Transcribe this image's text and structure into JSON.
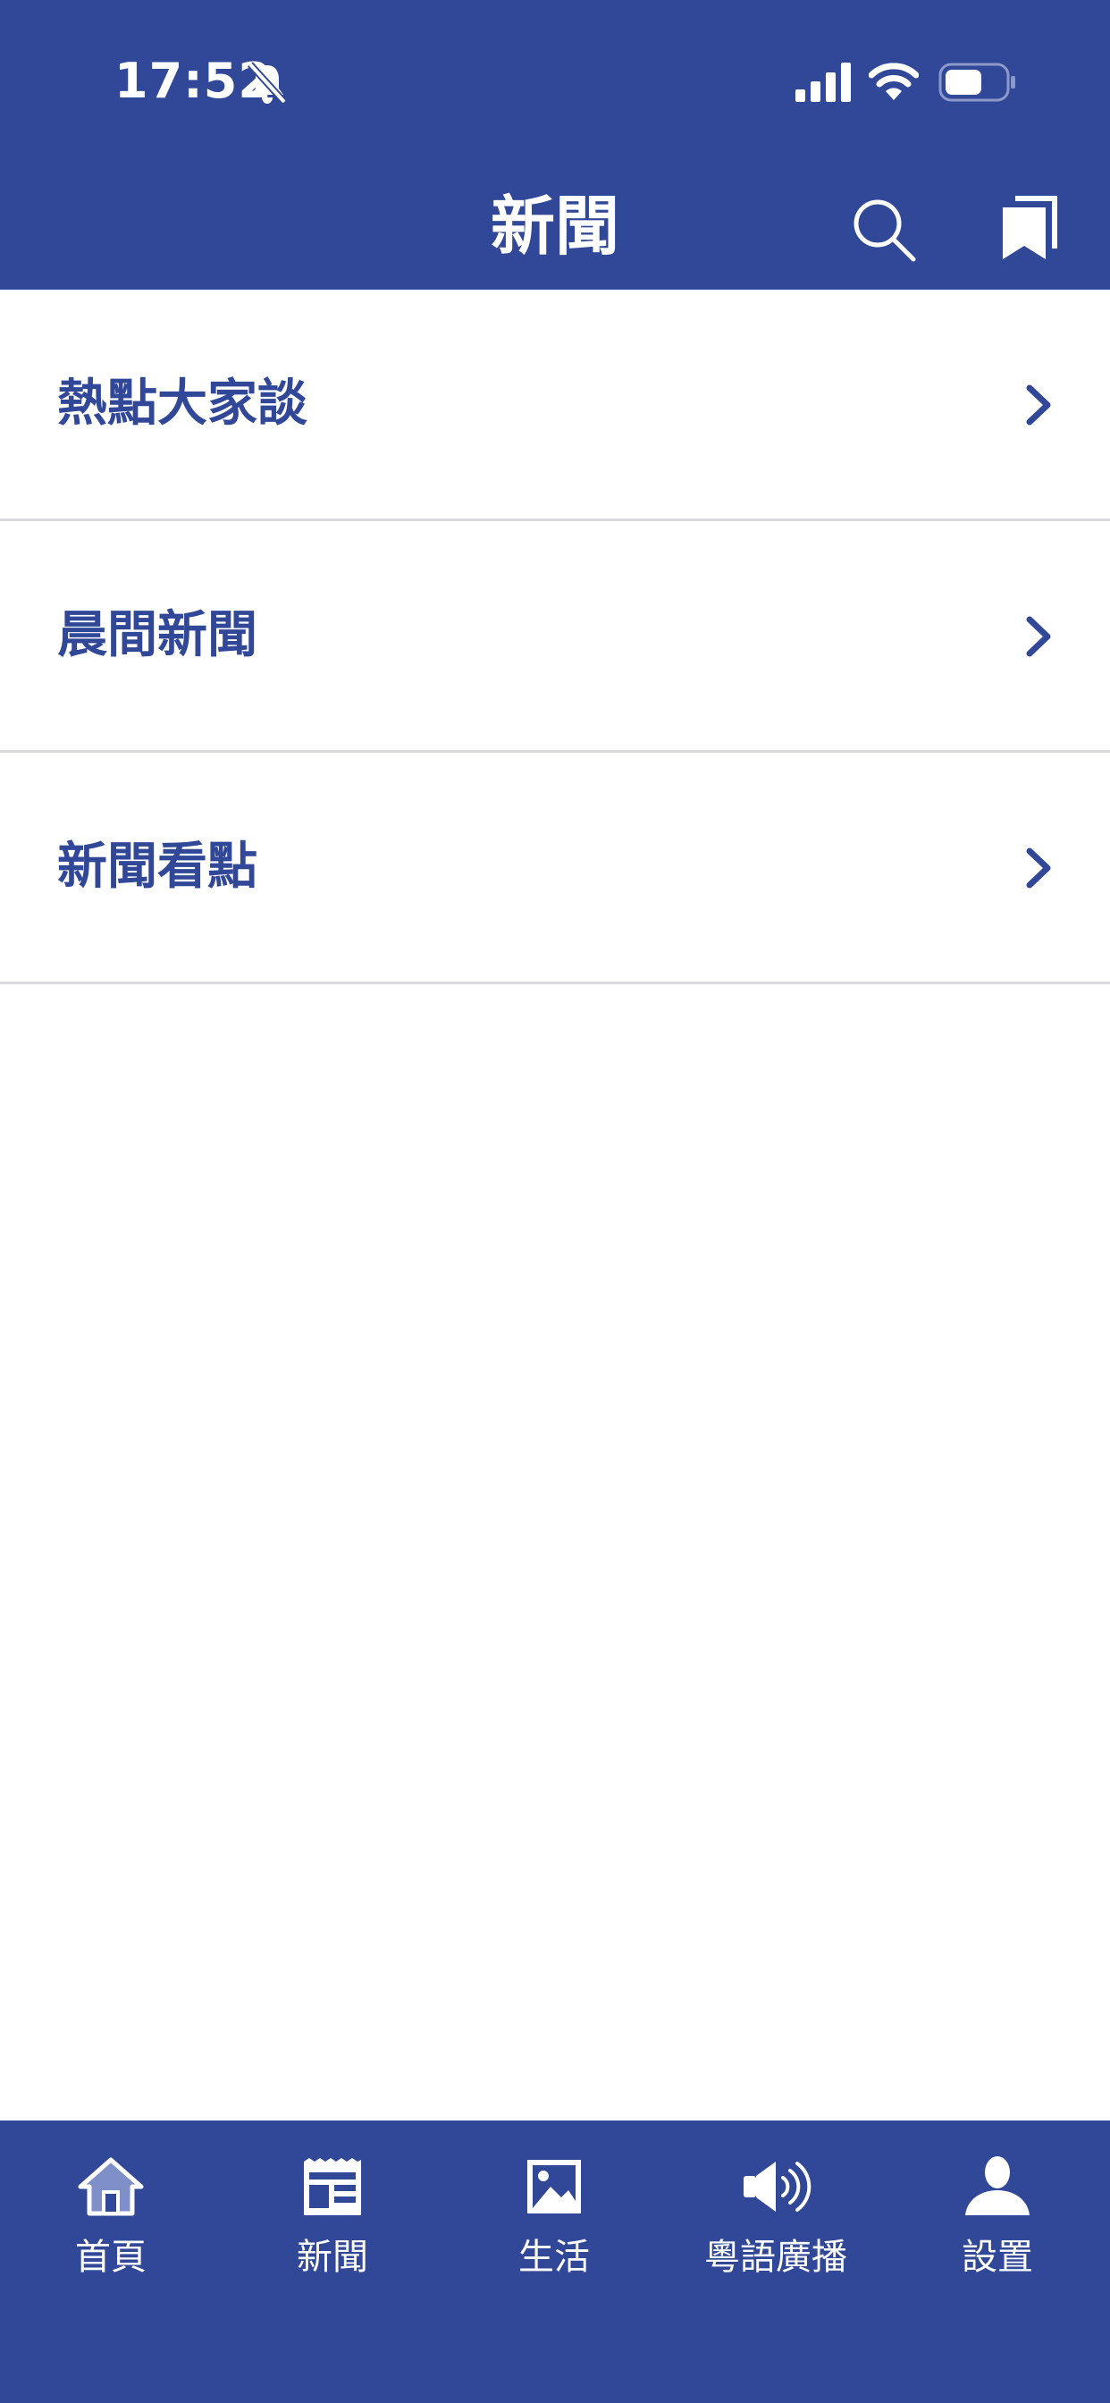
{
  "status_bar": {
    "time": "17:52",
    "icons": [
      "bell-slash-icon",
      "cellular-signal-icon",
      "wifi-icon",
      "battery-icon"
    ]
  },
  "header": {
    "title": "新聞",
    "actions": [
      {
        "icon": "search-icon"
      },
      {
        "icon": "bookmark-icon"
      }
    ]
  },
  "menu": {
    "items": [
      {
        "label": "熱點大家談"
      },
      {
        "label": "晨間新聞"
      },
      {
        "label": "新聞看點"
      }
    ]
  },
  "tab_bar": {
    "tabs": [
      {
        "label": "首頁",
        "icon": "home-icon"
      },
      {
        "label": "新聞",
        "icon": "newspaper-icon"
      },
      {
        "label": "生活",
        "icon": "picture-icon"
      },
      {
        "label": "粵語廣播",
        "icon": "speaker-icon"
      },
      {
        "label": "設置",
        "icon": "user-icon"
      }
    ]
  },
  "colors": {
    "brand": "#314797",
    "background": "#ffffff",
    "divider": "#d9d9de",
    "home_icon_fill": "#7f8fc8"
  }
}
